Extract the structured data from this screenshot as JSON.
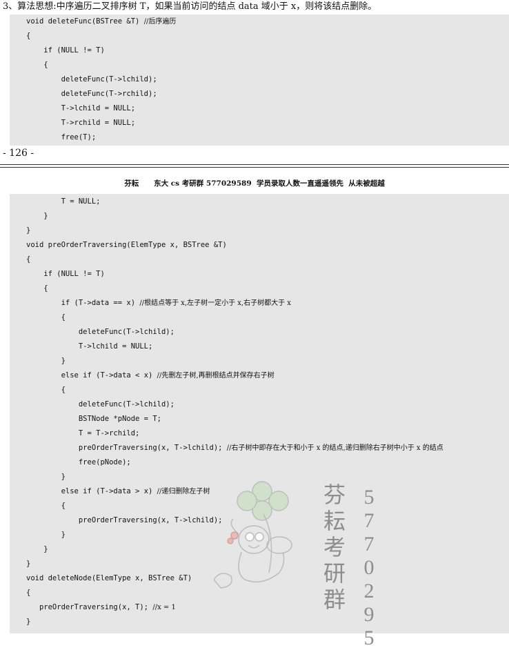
{
  "intro": "3、算法思想:中序遍历二叉排序树 T，如果当前访问的结点 data 域小于 x，则将该结点删除。",
  "block1": [
    {
      "code": "void deleteFunc(BSTree &T) ",
      "comment": "//后序遍历"
    },
    {
      "code": "{",
      "comment": ""
    },
    {
      "code": "    if (NULL != T)",
      "comment": ""
    },
    {
      "code": "    {",
      "comment": ""
    },
    {
      "code": "        deleteFunc(T->lchild);",
      "comment": ""
    },
    {
      "code": "        deleteFunc(T->rchild);",
      "comment": ""
    },
    {
      "code": "        T->lchild = NULL;",
      "comment": ""
    },
    {
      "code": "        T->rchild = NULL;",
      "comment": ""
    },
    {
      "code": "        free(T);",
      "comment": ""
    }
  ],
  "page_number": "- 126 -",
  "header": "芬耘      东大 cs 考研群 577029589  学员录取人数一直遥遥领先  从未被超越",
  "block2": [
    {
      "code": "        T = NULL;",
      "comment": ""
    },
    {
      "code": "    }",
      "comment": ""
    },
    {
      "code": "}",
      "comment": ""
    },
    {
      "code": "void preOrderTraversing(ElemType x, BSTree &T)",
      "comment": ""
    },
    {
      "code": "{",
      "comment": ""
    },
    {
      "code": "    if (NULL != T)",
      "comment": ""
    },
    {
      "code": "    {",
      "comment": ""
    },
    {
      "code": "        if (T->data == x) ",
      "comment": "//根结点等于 x,左子树一定小于 x,右子树都大于 x"
    },
    {
      "code": "        {",
      "comment": ""
    },
    {
      "code": "            deleteFunc(T->lchild);",
      "comment": ""
    },
    {
      "code": "            T->lchild = NULL;",
      "comment": ""
    },
    {
      "code": "        }",
      "comment": ""
    },
    {
      "code": "        else if (T->data < x) ",
      "comment": "//先删左子树,再删根结点并保存右子树"
    },
    {
      "code": "        {",
      "comment": ""
    },
    {
      "code": "            deleteFunc(T->lchild);",
      "comment": ""
    },
    {
      "code": "            BSTNode *pNode = T;",
      "comment": ""
    },
    {
      "code": "            T = T->rchild;",
      "comment": ""
    },
    {
      "code": "            preOrderTraversing(x, T->lchild); ",
      "comment": "//右子树中即存在大于和小于 x 的结点,递归删除右子树中小于 x 的结点"
    },
    {
      "code": "            free(pNode);",
      "comment": ""
    },
    {
      "code": "        }",
      "comment": ""
    },
    {
      "code": "        else if (T->data > x) ",
      "comment": "//递归删除左子树"
    },
    {
      "code": "        {",
      "comment": ""
    },
    {
      "code": "            preOrderTraversing(x, T->lchild);",
      "comment": ""
    },
    {
      "code": "        }",
      "comment": ""
    },
    {
      "code": "    }",
      "comment": ""
    },
    {
      "code": "}",
      "comment": ""
    },
    {
      "code": "void deleteNode(ElemType x, BSTree &T)",
      "comment": ""
    },
    {
      "code": "{",
      "comment": ""
    },
    {
      "code": "   preOrderTraversing(x, T); ",
      "comment": "//x = 1"
    },
    {
      "code": "}",
      "comment": ""
    }
  ],
  "watermark": {
    "chars": [
      "芬",
      "耘",
      "考",
      "研",
      "群"
    ],
    "digits": [
      "5",
      "7",
      "7",
      "0",
      "2",
      "9",
      "5"
    ]
  }
}
